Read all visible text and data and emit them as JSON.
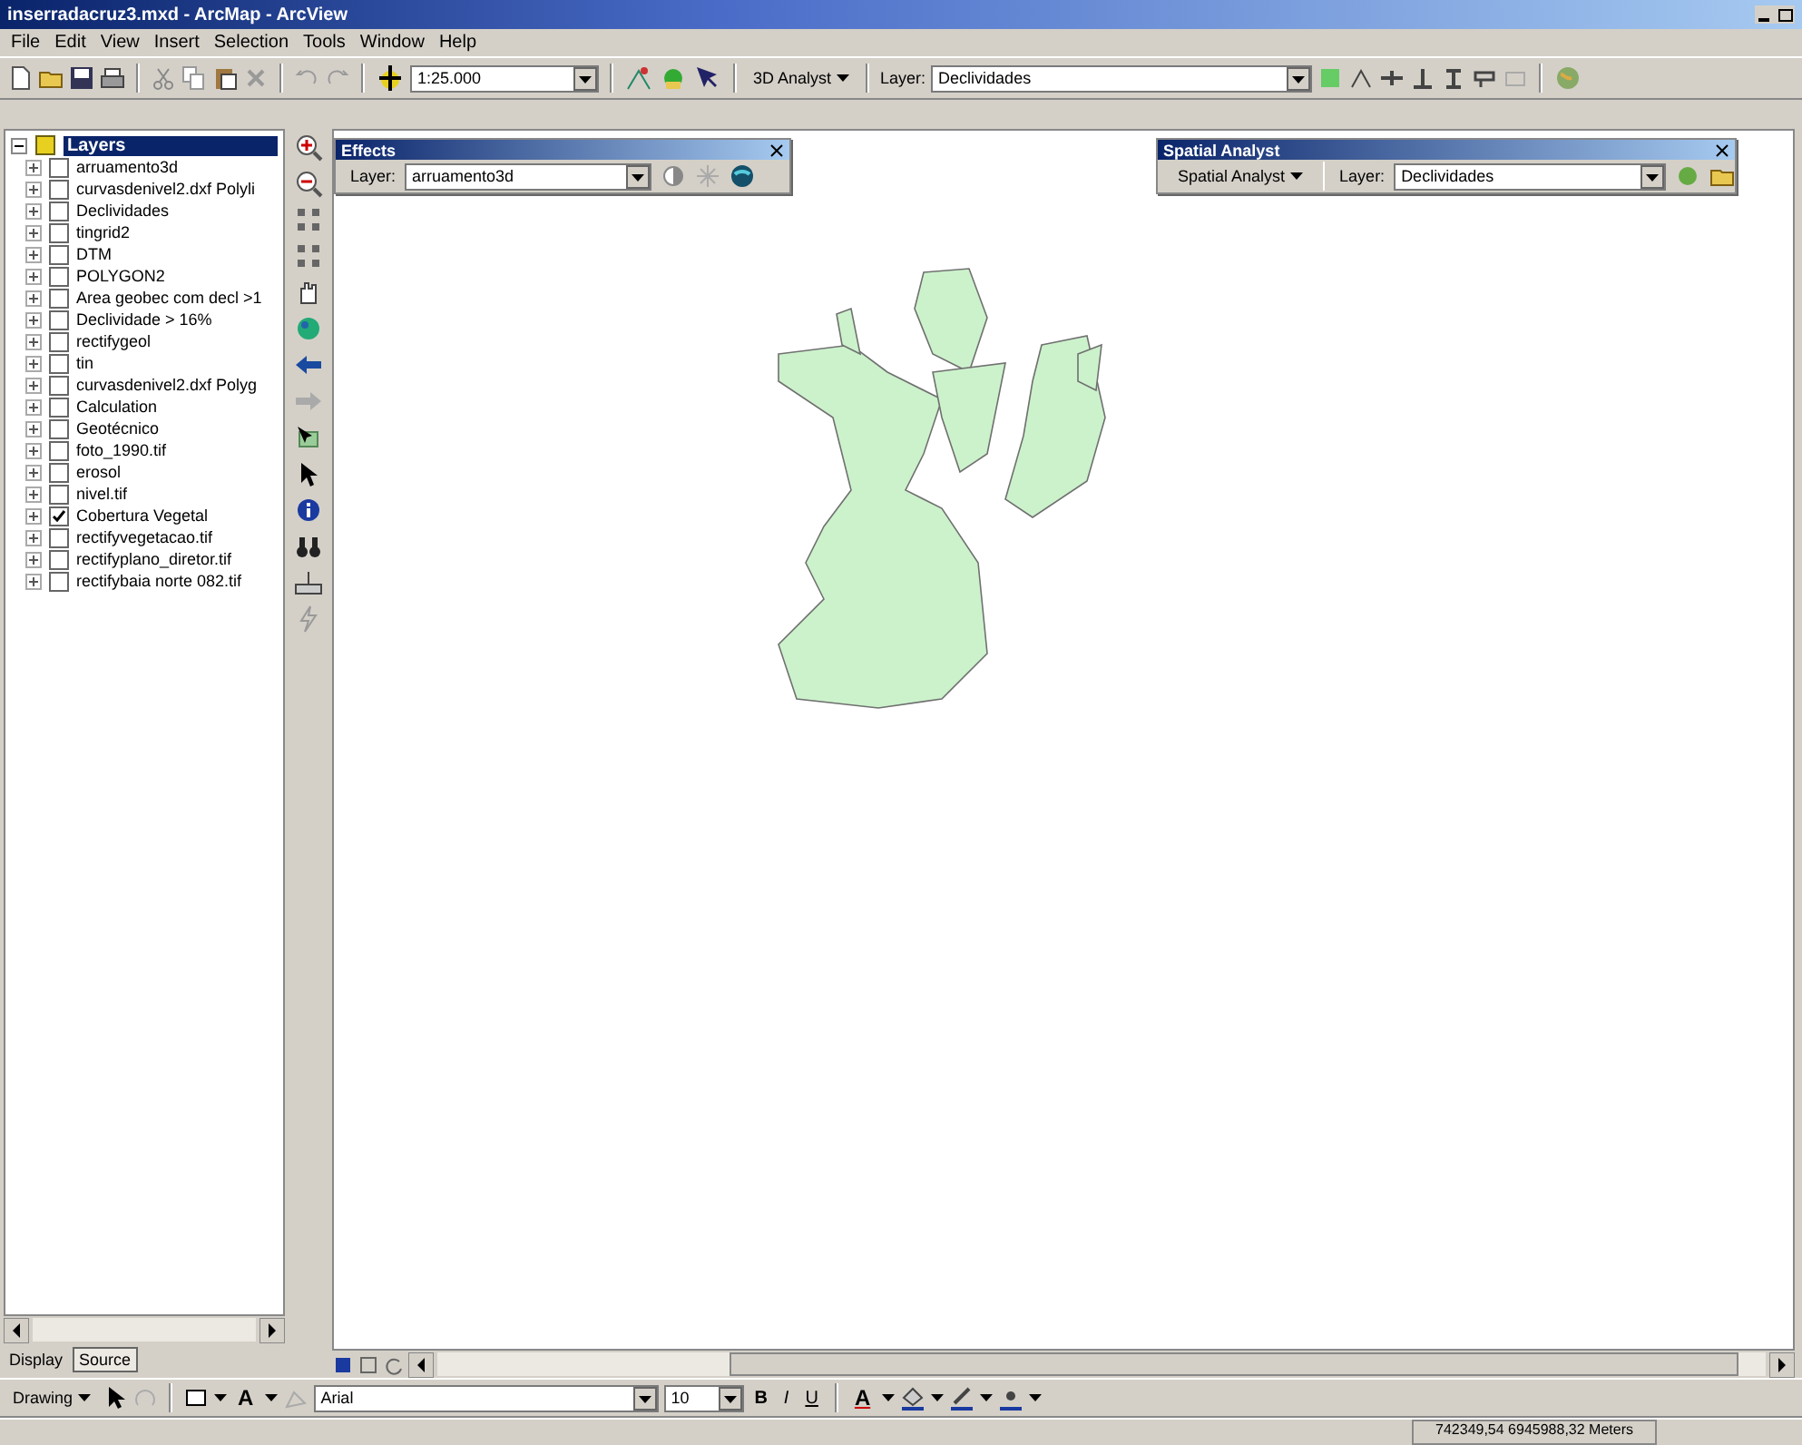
{
  "window": {
    "title": "inserradacruz3.mxd - ArcMap - ArcView"
  },
  "menu": [
    "File",
    "Edit",
    "View",
    "Insert",
    "Selection",
    "Tools",
    "Window",
    "Help"
  ],
  "standard_toolbar": {
    "scale": "1:25.000",
    "analyst_menu": "3D Analyst",
    "layer_label": "Layer:",
    "layer": "Declividades"
  },
  "toc": {
    "root": {
      "label": "Layers",
      "selected": true,
      "expanded": true,
      "children": [
        {
          "label": "arruamento3d",
          "checked": false
        },
        {
          "label": "curvasdenivel2.dxf Polyli",
          "checked": false
        },
        {
          "label": "Declividades",
          "checked": false
        },
        {
          "label": "tingrid2",
          "checked": false
        },
        {
          "label": "DTM",
          "checked": false
        },
        {
          "label": "POLYGON2",
          "checked": false
        },
        {
          "label": "Area geobec com decl >1",
          "checked": false
        },
        {
          "label": "Declividade > 16%",
          "checked": false
        },
        {
          "label": "rectifygeol",
          "checked": false
        },
        {
          "label": "tin",
          "checked": false
        },
        {
          "label": "curvasdenivel2.dxf Polyg",
          "checked": false
        },
        {
          "label": "Calculation",
          "checked": false
        },
        {
          "label": "Geotécnico",
          "checked": false
        },
        {
          "label": "foto_1990.tif",
          "checked": false
        },
        {
          "label": "erosol",
          "checked": false
        },
        {
          "label": "nivel.tif",
          "checked": false
        },
        {
          "label": "Cobertura Vegetal",
          "checked": true
        },
        {
          "label": "rectifyvegetacao.tif",
          "checked": false
        },
        {
          "label": "rectifyplano_diretor.tif",
          "checked": false
        },
        {
          "label": "rectifybaia norte 082.tif",
          "checked": false
        }
      ]
    }
  },
  "toc_tabs": [
    {
      "label": "Display",
      "selected": false
    },
    {
      "label": "Source",
      "selected": true
    }
  ],
  "effects_toolbar": {
    "title": "Effects",
    "layer_label": "Layer:",
    "layer": "arruamento3d"
  },
  "spatial_analyst_toolbar": {
    "title": "Spatial Analyst",
    "analyst_menu": "Spatial Analyst",
    "layer_label": "Layer:",
    "layer": "Declividades"
  },
  "drawing_toolbar": {
    "menu": "Drawing",
    "text_tool": "A",
    "font": "Arial",
    "size": "10",
    "format_buttons": [
      "B",
      "I",
      "U"
    ],
    "font_color": "A"
  },
  "status_bar": {
    "coordinates": "742349,54  6945988,32 Meters"
  }
}
